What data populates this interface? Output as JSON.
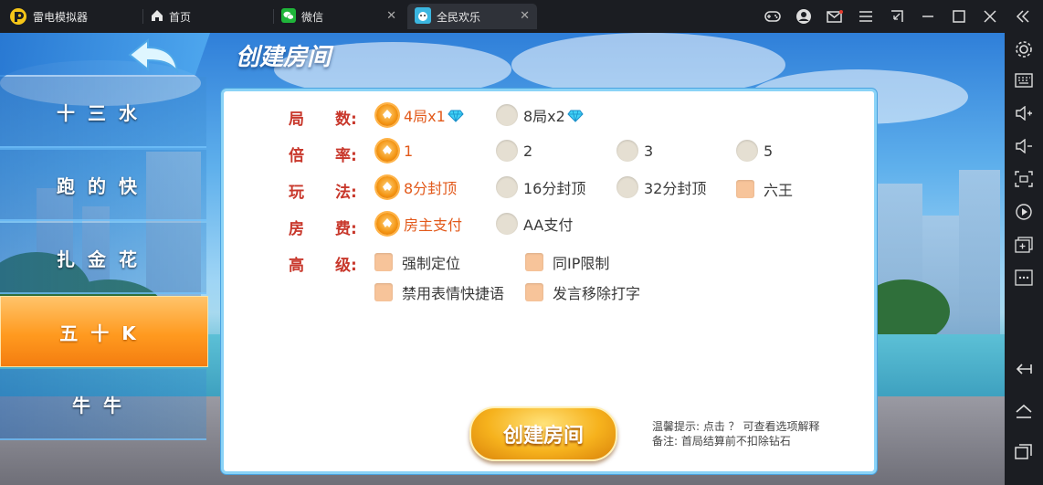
{
  "titlebar": {
    "app_name": "雷电模拟器",
    "tabs": [
      {
        "label": "首页",
        "icon": "home-icon"
      },
      {
        "label": "微信",
        "icon": "wechat-icon"
      },
      {
        "label": "全民欢乐",
        "icon": "game-icon",
        "active": true
      }
    ]
  },
  "game": {
    "title": "创建房间",
    "menu": [
      {
        "label": "十三水"
      },
      {
        "label": "跑的快"
      },
      {
        "label": "扎金花"
      },
      {
        "label": "五十K",
        "active": true
      },
      {
        "label": "牛牛"
      }
    ],
    "rows": {
      "rounds": {
        "label": "局　　数:",
        "options": [
          "4局x1",
          "8局x2"
        ],
        "selected": 0
      },
      "rate": {
        "label": "倍　　率:",
        "options": [
          "1",
          "2",
          "3",
          "5"
        ],
        "selected": 0
      },
      "play": {
        "label": "玩　　法:",
        "options": [
          "8分封顶",
          "16分封顶",
          "32分封顶"
        ],
        "selected": 0,
        "checkbox": "六王"
      },
      "fee": {
        "label": "房　　费:",
        "options": [
          "房主支付",
          "AA支付"
        ],
        "selected": 0
      },
      "advanced": {
        "label": "高　　级:",
        "checkboxes": [
          "强制定位",
          "同IP限制",
          "禁用表情快捷语",
          "发言移除打字"
        ]
      }
    },
    "create_button": "创建房间",
    "hint_line1": "温馨提示: 点击 ？ 可查看选项解释",
    "hint_line2": "备注: 首局结算前不扣除钻石",
    "colors": {
      "accent": "#f39412",
      "label_red": "#c8372b",
      "dialog_border": "#8ad3f7"
    }
  }
}
